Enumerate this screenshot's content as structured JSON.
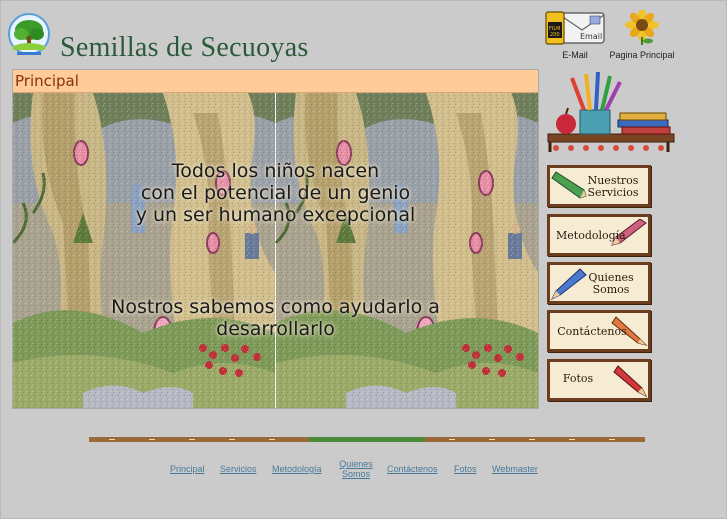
{
  "header": {
    "site_title": "Semillas de Secuoyas",
    "email_label": "E-Mail",
    "email_icon_text": "Email",
    "film_text": "FILM\n200",
    "home_label": "Pagina Principal"
  },
  "panel": {
    "title": "Principal",
    "message_1": [
      "Todos los niños nacen",
      "con el potencial de un genio",
      "y un ser humano excepcional"
    ],
    "message_2": [
      "Nostros sabemos como ayudarlo a",
      "desarrollarlo"
    ]
  },
  "side_nav": [
    {
      "label_1": "Nuestros",
      "label_2": "Servicios"
    },
    {
      "label_1": "Metodología",
      "label_2": ""
    },
    {
      "label_1": "Quienes",
      "label_2": "Somos"
    },
    {
      "label_1": "Contáctenos",
      "label_2": ""
    },
    {
      "label_1": "Fotos",
      "label_2": ""
    }
  ],
  "footer_nav": [
    "Principal",
    "Servicios",
    "Metodología",
    "Quienes",
    "Somos",
    "Contáctenos",
    "Fotos",
    "Webmaster"
  ],
  "colors": {
    "background": "#cbcbcb",
    "panel_header": "#ffcc99",
    "title_text": "#2b5a3a",
    "link": "#4a7a9a",
    "button_frame": "#6b3d1e"
  }
}
